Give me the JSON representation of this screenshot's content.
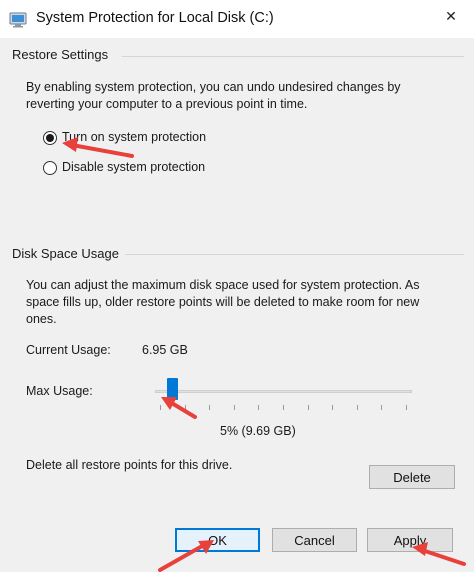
{
  "window": {
    "title": "System Protection for Local Disk (C:)",
    "close_glyph": "✕"
  },
  "restore_settings": {
    "heading": "Restore Settings",
    "description_line1": "By enabling system protection, you can undo undesired changes by",
    "description_line2": "reverting your computer to a previous point in time.",
    "options": [
      {
        "label": "Turn on system protection",
        "selected": true
      },
      {
        "label": "Disable system protection",
        "selected": false
      }
    ]
  },
  "disk_space": {
    "heading": "Disk Space Usage",
    "description_line1": "You can adjust the maximum disk space used for system protection. As",
    "description_line2": "space fills up, older restore points will be deleted to make room for new",
    "description_line3": "ones.",
    "current_usage_label": "Current Usage:",
    "current_usage_value": "6.95 GB",
    "max_usage_label": "Max Usage:",
    "max_usage_fraction": 0.05,
    "max_usage_value_text": "5% (9.69 GB)",
    "delete_text": "Delete all restore points for this drive.",
    "delete_button": "Delete"
  },
  "footer": {
    "ok": "OK",
    "cancel": "Cancel",
    "apply": "Apply"
  },
  "colors": {
    "accent": "#0078d7",
    "annotation_arrow": "#e8403a",
    "dialog_bg": "#f0f0f0"
  }
}
